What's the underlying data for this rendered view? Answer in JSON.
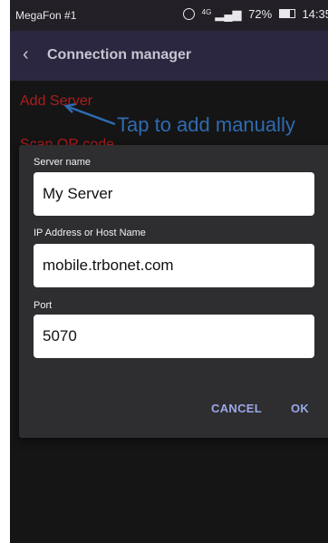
{
  "status_bar": {
    "carrier": "MegaFon #1",
    "network": "4G",
    "battery": "72%",
    "time": "14:35"
  },
  "app_bar": {
    "title": "Connection manager"
  },
  "menu": {
    "add_server": "Add Server",
    "scan_qr": "Scan QR code"
  },
  "annotation": {
    "text": "Tap to add manually",
    "color": "#2f6bb0"
  },
  "dialog": {
    "server_name_label": "Server name",
    "server_name_value": "My Server",
    "host_label": "IP Address or Host Name",
    "host_value": "mobile.trbonet.com",
    "port_label": "Port",
    "port_value": "5070",
    "cancel_label": "CANCEL",
    "ok_label": "OK"
  },
  "colors": {
    "app_bar": "#2c2740",
    "menu_text": "#ae1c1c",
    "dialog_bg": "#2e2d30",
    "button_text": "#9aa8e8"
  }
}
